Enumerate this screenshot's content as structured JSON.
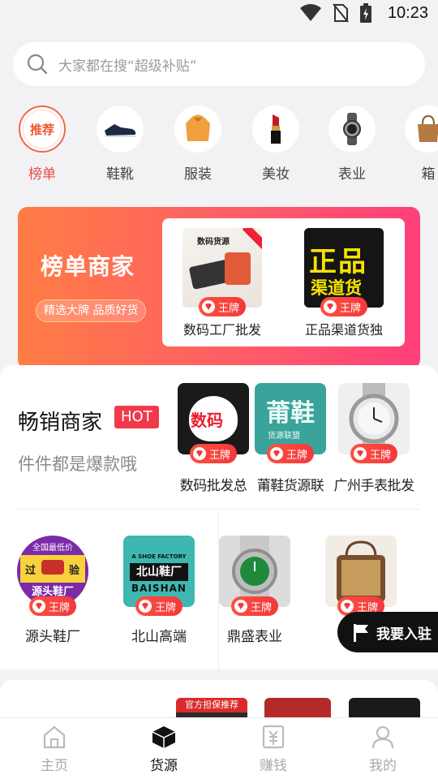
{
  "status_bar": {
    "time": "10:23"
  },
  "search": {
    "placeholder": "大家都在搜“超级补贴”"
  },
  "categories": [
    {
      "label": "榜单",
      "icon": "推荐"
    },
    {
      "label": "鞋靴",
      "icon": "shoe-icon"
    },
    {
      "label": "服装",
      "icon": "hoodie-icon"
    },
    {
      "label": "美妆",
      "icon": "lipstick-icon"
    },
    {
      "label": "表业",
      "icon": "watch-icon"
    },
    {
      "label": "箱",
      "icon": "bag-icon"
    }
  ],
  "banner": {
    "title": "榜单商家",
    "pill": "精选大牌 品质好货",
    "items": [
      {
        "name": "数码工厂批发",
        "img_text": "数码货源",
        "badge": "王牌"
      },
      {
        "name": "正品渠道货独",
        "img_text_1": "正品",
        "img_text_2": "渠道货",
        "badge": "王牌"
      }
    ]
  },
  "hot_section": {
    "title": "畅销商家",
    "tag": "HOT",
    "subtitle": "件件都是爆款哦",
    "items": [
      {
        "name": "数码批发总",
        "img_text": "数码",
        "badge": "王牌"
      },
      {
        "name": "莆鞋货源联",
        "img_text": "莆鞋",
        "img_sub": "货源联盟",
        "badge": "王牌"
      },
      {
        "name": "广州手表批发",
        "badge": "王牌"
      }
    ],
    "bottom_items": [
      {
        "name": "源头鞋厂",
        "img_top": "全国最低价",
        "img_mid_l": "过",
        "img_mid_r": "验",
        "img_bottom": "源头鞋厂",
        "badge": "王牌"
      },
      {
        "name": "北山高端",
        "img_top": "A SHOE FACTORY",
        "img_mid": "北山鞋厂",
        "img_bottom": "BAISHAN",
        "badge": "王牌"
      },
      {
        "name": "鼎盛表业",
        "badge": "王牌"
      },
      {
        "name": "包",
        "badge": "王牌"
      }
    ]
  },
  "join_button": {
    "label": "我要入驻"
  },
  "next_section": {
    "peek_label": "官方担保推荐"
  },
  "tabbar": [
    {
      "label": "主页",
      "icon": "home-icon"
    },
    {
      "label": "货源",
      "icon": "box-icon"
    },
    {
      "label": "赚钱",
      "icon": "money-icon"
    },
    {
      "label": "我的",
      "icon": "user-icon"
    }
  ],
  "colors": {
    "accent": "#e9493f",
    "badge": "#f2393d",
    "hot_tag": "#f2394c"
  }
}
